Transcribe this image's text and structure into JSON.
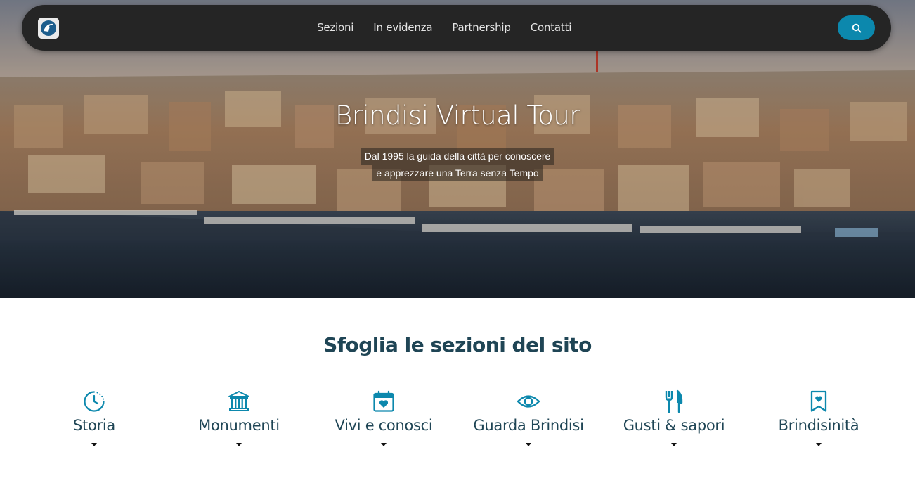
{
  "nav": {
    "links": [
      "Sezioni",
      "In evidenza",
      "Partnership",
      "Contatti"
    ],
    "search_icon": "search-icon",
    "logo_icon": "site-logo"
  },
  "hero": {
    "title": "Brindisi Virtual Tour",
    "subtitle_line1": "Dal 1995 la guida della città per conoscere",
    "subtitle_line2": "e apprezzare una Terra senza Tempo"
  },
  "sections": {
    "heading": "Sfoglia le sezioni del sito",
    "items": [
      {
        "label": "Storia",
        "icon": "clock-icon"
      },
      {
        "label": "Monumenti",
        "icon": "monument-icon"
      },
      {
        "label": "Vivi e conosci",
        "icon": "calendar-heart-icon"
      },
      {
        "label": "Guarda Brindisi",
        "icon": "eye-icon"
      },
      {
        "label": "Gusti & sapori",
        "icon": "fork-knife-icon"
      },
      {
        "label": "Brindisinità",
        "icon": "bookmark-heart-icon"
      }
    ]
  },
  "colors": {
    "accent": "#0c88ad",
    "heading": "#1f4555",
    "navbar": "#252525"
  }
}
